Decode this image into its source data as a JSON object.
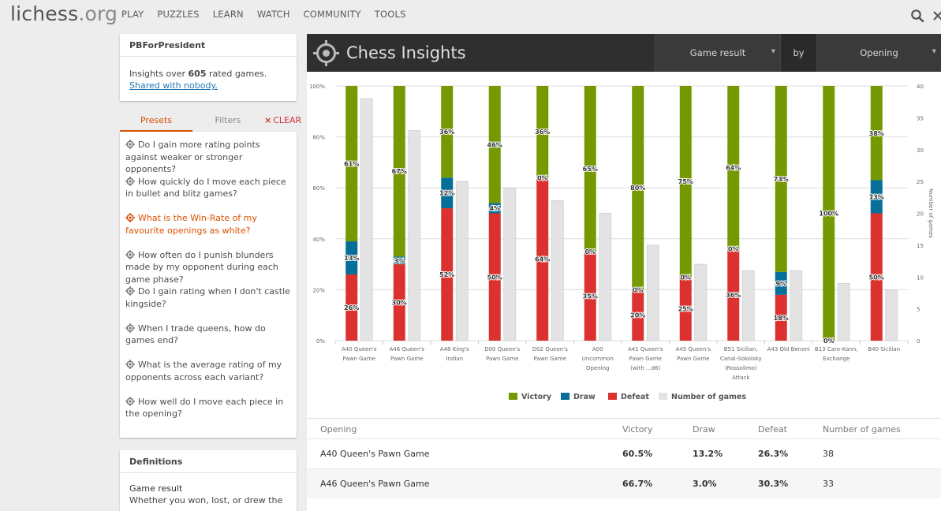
{
  "site": {
    "logo_main": "lichess",
    "logo_tld": ".org"
  },
  "nav": [
    "PLAY",
    "PUZZLES",
    "LEARN",
    "WATCH",
    "COMMUNITY",
    "TOOLS"
  ],
  "user": {
    "name": "PBForPresident",
    "insights_prefix": "Insights over ",
    "games_count": "605",
    "insights_suffix": " rated games.",
    "share_text": "Shared with nobody."
  },
  "tabs": {
    "presets": "Presets",
    "filters": "Filters",
    "clear": "CLEAR",
    "clear_icon": "×"
  },
  "presets": [
    "Do I gain more rating points against weaker or stronger opponents?",
    "How quickly do I move each piece in bullet and blitz games?",
    "What is the Win-Rate of my favourite openings as white?",
    "How often do I punish blunders made by my opponent during each game phase?",
    "Do I gain rating when I don't castle kingside?",
    "When I trade queens, how do games end?",
    "What is the average rating of my opponents across each variant?",
    "How well do I move each piece in the opening?"
  ],
  "active_preset": 2,
  "definitions": {
    "title": "Definitions",
    "term": "Game result",
    "description": "Whether you won, lost, or drew the"
  },
  "header": {
    "title": "Chess Insights",
    "metric": "Game result",
    "by": "by",
    "dimension": "Opening"
  },
  "colors": {
    "victory": "#759900",
    "draw": "#056e99",
    "defeat": "#dc322f",
    "games": "#e3e3e3",
    "accent": "#d85000"
  },
  "chart_data": {
    "type": "bar",
    "stacked": true,
    "categories": [
      "A40 Queen's Pawn Game",
      "A46 Queen's Pawn Game",
      "A48 King's Indian",
      "D00 Queen's Pawn Game",
      "D02 Queen's Pawn Game",
      "A00 Uncommon Opening",
      "A41 Queen's Pawn Game (with ...d6)",
      "A45 Queen's Pawn Game",
      "B51 Sicilian, Canal-Sokolsky (Rossolimo) Attack",
      "A43 Old Benoni",
      "B13 Caro-Kann, Exchange",
      "B40 Sicilian"
    ],
    "category_lines": [
      [
        "A40 Queen's",
        "Pawn Game"
      ],
      [
        "A46 Queen's",
        "Pawn Game"
      ],
      [
        "A48 King's",
        "Indian"
      ],
      [
        "D00 Queen's",
        "Pawn Game"
      ],
      [
        "D02 Queen's",
        "Pawn Game"
      ],
      [
        "A00",
        "Uncommon",
        "Opening"
      ],
      [
        "A41 Queen's",
        "Pawn Game",
        "(with ...d6)"
      ],
      [
        "A45 Queen's",
        "Pawn Game"
      ],
      [
        "B51 Sicilian,",
        "Canal-Sokolsky",
        "(Rossolimo)",
        "Attack"
      ],
      [
        "A43 Old Benoni"
      ],
      [
        "B13 Caro-Kann,",
        "Exchange"
      ],
      [
        "B40 Sicilian"
      ]
    ],
    "series": [
      {
        "name": "Victory",
        "values": [
          61,
          67,
          36,
          46,
          36,
          65,
          80,
          75,
          64,
          73,
          100,
          38
        ],
        "labels": [
          "61%",
          "67%",
          "36%",
          "46%",
          "36%",
          "65%",
          "80%",
          "75%",
          "64%",
          "73%",
          "100%",
          "38%"
        ]
      },
      {
        "name": "Draw",
        "values": [
          13,
          3,
          12,
          4,
          0,
          0,
          0,
          0,
          0,
          9,
          0,
          13
        ],
        "labels": [
          "13%",
          "3%",
          "12%",
          "4%",
          "0%",
          "0%",
          "0%",
          "0%",
          "0%",
          "9%",
          "0%",
          "13%"
        ]
      },
      {
        "name": "Defeat",
        "values": [
          26,
          30,
          52,
          50,
          64,
          35,
          20,
          25,
          36,
          18,
          0,
          50
        ],
        "labels": [
          "26%",
          "30%",
          "52%",
          "50%",
          "64%",
          "35%",
          "20%",
          "25%",
          "36%",
          "18%",
          "0%",
          "50%"
        ]
      },
      {
        "name": "Number of games",
        "values": [
          38,
          33,
          25,
          24,
          22,
          20,
          15,
          12,
          11,
          11,
          9,
          8
        ],
        "axis": "right"
      }
    ],
    "y_ticks": [
      "0%",
      "20%",
      "40%",
      "60%",
      "80%",
      "100%"
    ],
    "ylim": [
      0,
      100
    ],
    "y2_ticks": [
      "0",
      "5",
      "10",
      "15",
      "20",
      "25",
      "30",
      "35",
      "40"
    ],
    "y2lim": [
      0,
      40
    ],
    "y2label": "Number of games",
    "legend_position": "bottom"
  },
  "table": {
    "headers": [
      "Opening",
      "Victory",
      "Draw",
      "Defeat",
      "Number of games"
    ],
    "rows": [
      [
        "A40 Queen's Pawn Game",
        "60.5%",
        "13.2%",
        "26.3%",
        "38"
      ],
      [
        "A46 Queen's Pawn Game",
        "66.7%",
        "3.0%",
        "30.3%",
        "33"
      ]
    ]
  }
}
